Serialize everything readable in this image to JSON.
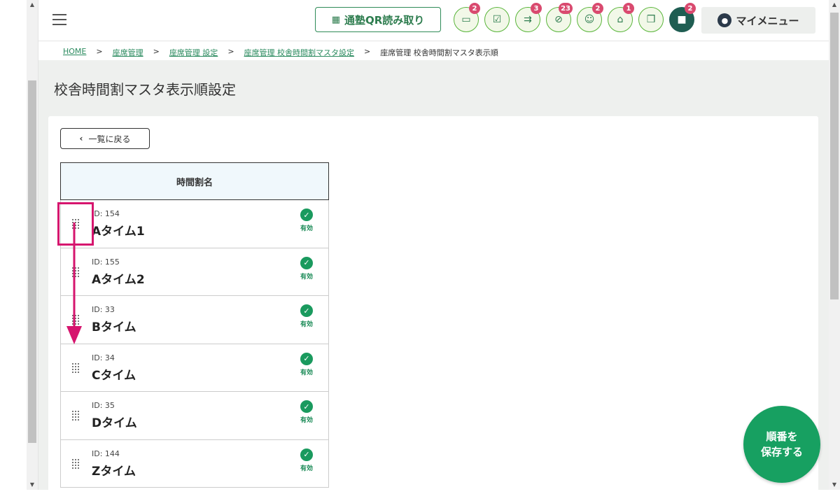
{
  "header": {
    "qr_button_label": "通塾QR読み取り",
    "icons": [
      {
        "name": "chat-bubble-icon",
        "badge": "2",
        "glyph": "▭"
      },
      {
        "name": "checklist-icon",
        "badge": "",
        "glyph": "☑"
      },
      {
        "name": "merge-arrows-icon",
        "badge": "3",
        "glyph": "⇉"
      },
      {
        "name": "disabled-icon",
        "badge": "23",
        "glyph": "⊘"
      },
      {
        "name": "group-icon",
        "badge": "2",
        "glyph": "☺"
      },
      {
        "name": "bank-icon",
        "badge": "1",
        "glyph": "⌂"
      },
      {
        "name": "gift-icon",
        "badge": "",
        "glyph": "❒"
      },
      {
        "name": "message-icon",
        "badge": "2",
        "glyph": "■"
      }
    ],
    "my_menu_label": "マイメニュー"
  },
  "breadcrumb": {
    "home": "HOME",
    "item1": "座席管理",
    "item2": "座席管理 設定",
    "item3": "座席管理 校舎時間割マスタ設定",
    "current": "座席管理 校舎時間割マスタ表示順",
    "separator": ">"
  },
  "page": {
    "title": "校舎時間割マスタ表示順設定",
    "back_label": "一覧に戻る"
  },
  "table": {
    "header": "時間割名",
    "rows": [
      {
        "id": "ID: 154",
        "name": "Aタイム1",
        "status": "有効"
      },
      {
        "id": "ID: 155",
        "name": "Aタイム2",
        "status": "有効"
      },
      {
        "id": "ID: 33",
        "name": "Bタイム",
        "status": "有効"
      },
      {
        "id": "ID: 34",
        "name": "Cタイム",
        "status": "有効"
      },
      {
        "id": "ID: 35",
        "name": "Dタイム",
        "status": "有効"
      },
      {
        "id": "ID: 144",
        "name": "Zタイム",
        "status": "有効"
      }
    ]
  },
  "fab": {
    "line1": "順番を",
    "line2": "保存する"
  },
  "colors": {
    "accent": "#17a061",
    "highlight": "#d6156e",
    "badge": "#d94a6f"
  }
}
